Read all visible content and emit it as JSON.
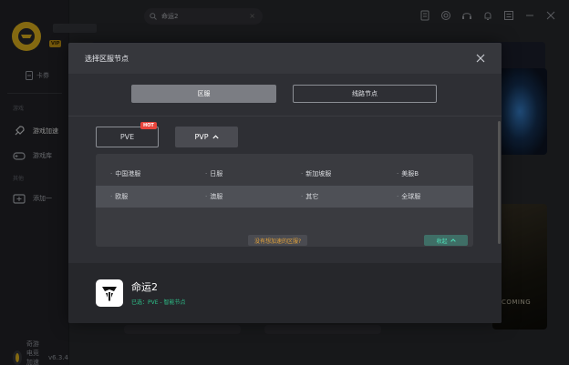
{
  "app": {
    "name": "奇游电竞加速器",
    "version": "v6.3.4",
    "vip_badge": "VIP"
  },
  "sidebar": {
    "card_label": "卡券",
    "section_games": "游戏",
    "items": [
      {
        "label": "游戏加速",
        "icon": "rocket-icon"
      },
      {
        "label": "游戏库",
        "icon": "gamepad-icon"
      },
      {
        "label": "添加一",
        "icon": "add-game-icon"
      }
    ],
    "section_other": "其他"
  },
  "search": {
    "value": "命运2",
    "clear": "×"
  },
  "modal": {
    "title": "选择区服节点",
    "tabs": [
      {
        "label": "区服",
        "active": true
      },
      {
        "label": "线路节点",
        "active": false
      }
    ],
    "modes": [
      {
        "label": "PVE",
        "badge": "HOT"
      },
      {
        "label": "PVP",
        "selected": true
      }
    ],
    "regions": [
      [
        "中国港服",
        "日服",
        "新加坡服",
        "美服B"
      ],
      [
        "欧服",
        "澳服",
        "其它",
        "全球服"
      ]
    ],
    "help_link": "没有想加速的区服?",
    "collapse_label": "收起",
    "game": {
      "name": "命运2",
      "selected_text": "已选：PVE - 智能节点"
    }
  },
  "background": {
    "banner_text": "COMING"
  },
  "colors": {
    "accent_green": "#2ec28a",
    "accent_yellow": "#f0c020",
    "hot_red": "#e8453c",
    "link_orange": "#e5a43a"
  }
}
